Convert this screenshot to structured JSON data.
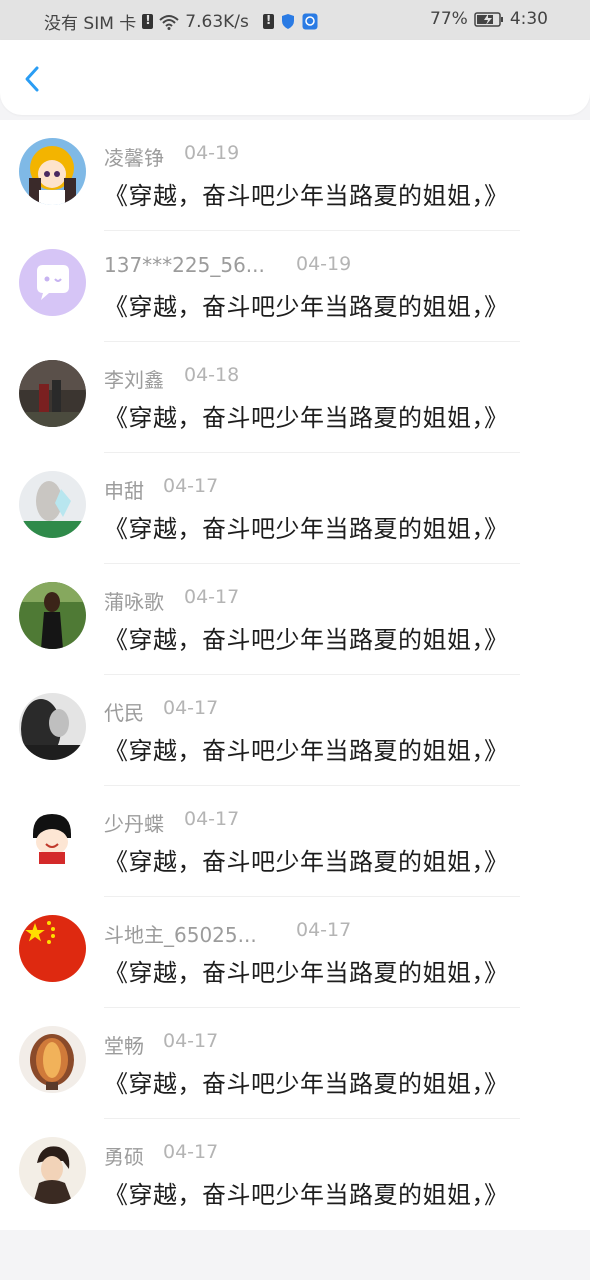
{
  "status_bar": {
    "carrier": "没有 SIM 卡",
    "speed": "7.63K/s",
    "battery_percent": "77%",
    "time": "4:30"
  },
  "header": {
    "back_icon": "chevron-left-icon",
    "accent_color": "#2a9df4"
  },
  "comments": [
    {
      "name": "凌馨铮",
      "date": "04-19",
      "text": "《穿越，奋斗吧少年当路夏的姐姐，》",
      "avatar": "cartoon-girl-avatar"
    },
    {
      "name": "137***225_56...",
      "date": "04-19",
      "text": "《穿越，奋斗吧少年当路夏的姐姐，》",
      "avatar": "default-chat-avatar"
    },
    {
      "name": "李刘鑫",
      "date": "04-18",
      "text": "《穿越，奋斗吧少年当路夏的姐姐，》",
      "avatar": "photo-avatar"
    },
    {
      "name": "申甜",
      "date": "04-17",
      "text": "《穿越，奋斗吧少年当路夏的姐姐，》",
      "avatar": "photo-avatar"
    },
    {
      "name": "蒲咏歌",
      "date": "04-17",
      "text": "《穿越，奋斗吧少年当路夏的姐姐，》",
      "avatar": "photo-avatar"
    },
    {
      "name": "代民",
      "date": "04-17",
      "text": "《穿越，奋斗吧少年当路夏的姐姐，》",
      "avatar": "photo-avatar"
    },
    {
      "name": "少丹蝶",
      "date": "04-17",
      "text": "《穿越，奋斗吧少年当路夏的姐姐，》",
      "avatar": "cartoon-avatar"
    },
    {
      "name": "斗地主_65025...",
      "date": "04-17",
      "text": "《穿越，奋斗吧少年当路夏的姐姐，》",
      "avatar": "china-flag-avatar"
    },
    {
      "name": "堂畅",
      "date": "04-17",
      "text": "《穿越，奋斗吧少年当路夏的姐姐，》",
      "avatar": "photo-avatar"
    },
    {
      "name": "勇硕",
      "date": "04-17",
      "text": "《穿越，奋斗吧少年当路夏的姐姐，》",
      "avatar": "photo-avatar"
    }
  ]
}
